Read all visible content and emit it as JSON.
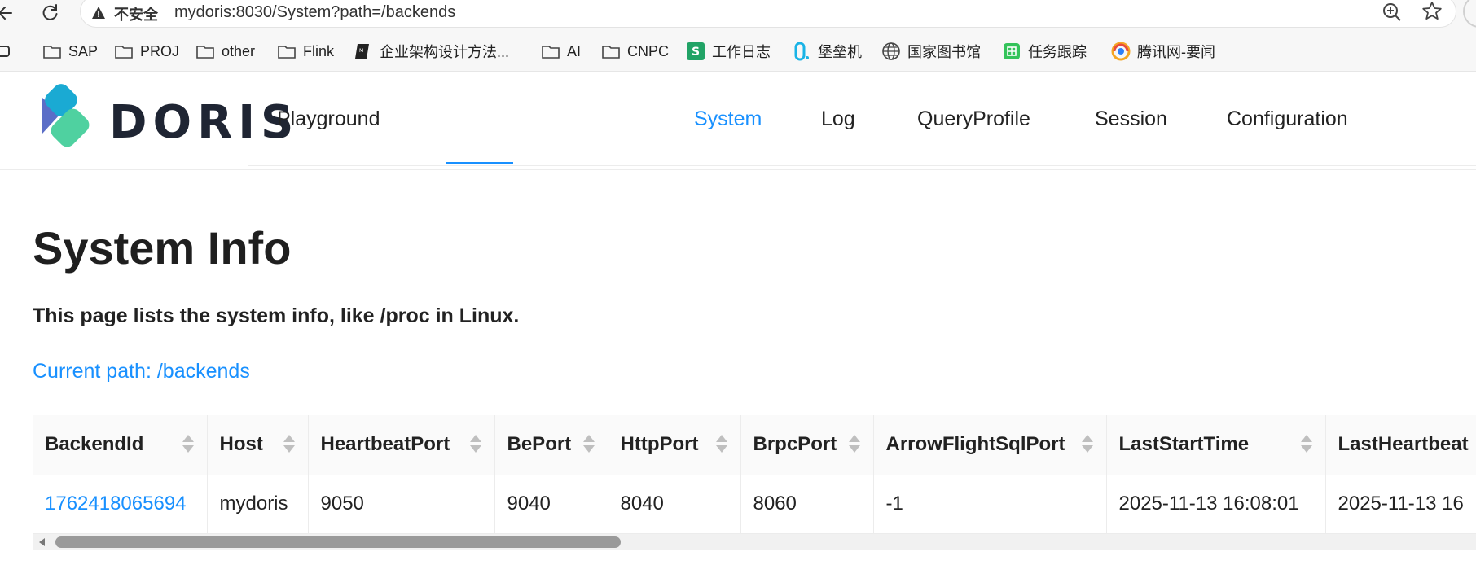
{
  "browser": {
    "security_label": "不安全",
    "url": "mydoris:8030/System?path=/backends",
    "bookmarks": [
      {
        "label": "SAP",
        "icon": "folder-icon"
      },
      {
        "label": "PROJ",
        "icon": "folder-icon"
      },
      {
        "label": "other",
        "icon": "folder-icon"
      },
      {
        "label": "Flink",
        "icon": "folder-icon"
      },
      {
        "label": "企业架构设计方法...",
        "icon": "book-icon"
      },
      {
        "label": "AI",
        "icon": "folder-icon"
      },
      {
        "label": "CNPC",
        "icon": "folder-icon"
      },
      {
        "label": "工作日志",
        "icon": "sheet-icon"
      },
      {
        "label": "堡垒机",
        "icon": "bastion-icon"
      },
      {
        "label": "国家图书馆",
        "icon": "globe-icon"
      },
      {
        "label": "任务跟踪",
        "icon": "grid-icon"
      },
      {
        "label": "腾讯网-要闻",
        "icon": "tencent-icon"
      }
    ]
  },
  "app": {
    "brand": "DORIS",
    "nav": [
      {
        "label": "Playground",
        "active": false
      },
      {
        "label": "System",
        "active": true
      },
      {
        "label": "Log",
        "active": false
      },
      {
        "label": "QueryProfile",
        "active": false
      },
      {
        "label": "Session",
        "active": false
      },
      {
        "label": "Configuration",
        "active": false
      }
    ],
    "accent_color": "#1890ff"
  },
  "page": {
    "title": "System Info",
    "description": "This page lists the system info, like /proc in Linux.",
    "current_path": "Current path: /backends"
  },
  "table": {
    "columns": [
      "BackendId",
      "Host",
      "HeartbeatPort",
      "BePort",
      "HttpPort",
      "BrpcPort",
      "ArrowFlightSqlPort",
      "LastStartTime",
      "LastHeartbeat"
    ],
    "rows": [
      [
        "1762418065694",
        "mydoris",
        "9050",
        "9040",
        "8040",
        "8060",
        "-1",
        "2025-11-13 16:08:01",
        "2025-11-13 16"
      ]
    ]
  }
}
